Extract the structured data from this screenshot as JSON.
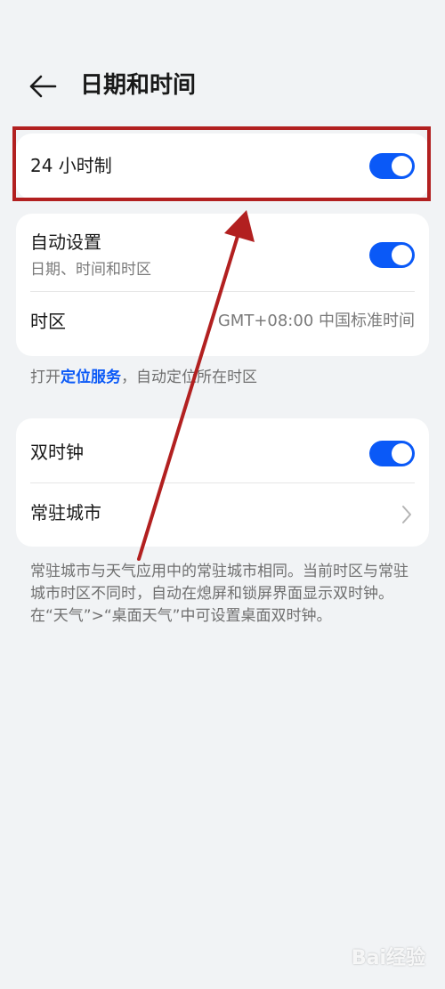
{
  "header": {
    "title": "日期和时间"
  },
  "settings": {
    "hour24": {
      "label": "24 小时制",
      "enabled": true
    },
    "auto": {
      "label": "自动设置",
      "sublabel": "日期、时间和时区",
      "enabled": true
    },
    "timezone": {
      "label": "时区",
      "value": "GMT+08:00 中国标准时间"
    },
    "location_hint": {
      "prefix": "打开",
      "link": "定位服务",
      "suffix": "，自动定位所在时区"
    },
    "dual_clock": {
      "label": "双时钟",
      "enabled": true
    },
    "home_city": {
      "label": "常驻城市"
    },
    "dual_hint": "常驻城市与天气应用中的常驻城市相同。当前时区与常驻城市时区不同时，自动在熄屏和锁屏界面显示双时钟。在“天气”>“桌面天气”中可设置桌面双时钟。"
  },
  "colors": {
    "toggle_on": "#0a59f7",
    "annotation": "#b22020",
    "background": "#f1f3f5"
  },
  "watermark": "Bai经验"
}
